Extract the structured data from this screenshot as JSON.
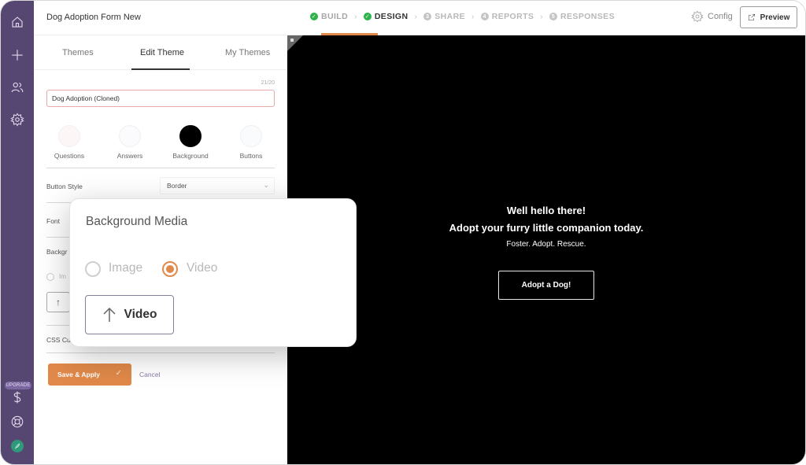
{
  "app": {
    "form_title": "Dog Adoption Form New"
  },
  "rail": {
    "items": [
      {
        "icon": "home-icon"
      },
      {
        "icon": "plus-icon"
      },
      {
        "icon": "users-icon"
      },
      {
        "icon": "gear-icon"
      }
    ],
    "upgrade_label": "UPGRADE",
    "bottom_items": [
      {
        "icon": "dollar-icon"
      },
      {
        "icon": "lifebuoy-icon"
      },
      {
        "icon": "avatar"
      }
    ]
  },
  "steps": [
    {
      "label": "BUILD",
      "marker": "✓",
      "state": "done"
    },
    {
      "label": "DESIGN",
      "marker": "✓",
      "state": "active"
    },
    {
      "label": "SHARE",
      "marker": "3",
      "state": "pending"
    },
    {
      "label": "REPORTS",
      "marker": "4",
      "state": "pending"
    },
    {
      "label": "RESPONSES",
      "marker": "5",
      "state": "pending"
    }
  ],
  "header": {
    "config_label": "Config",
    "preview_label": "Preview"
  },
  "panel": {
    "tabs": [
      {
        "label": "Themes"
      },
      {
        "label": "Edit Theme",
        "active": true
      },
      {
        "label": "My Themes"
      }
    ],
    "char_count": "21/20",
    "theme_name": "Dog Adoption (Cloned)",
    "swatches": [
      {
        "label": "Questions",
        "color": "#fdf6f6"
      },
      {
        "label": "Answers",
        "color": "#fbfbfd"
      },
      {
        "label": "Background",
        "color": "#000000"
      },
      {
        "label": "Buttons",
        "color": "#fafbfc"
      }
    ],
    "button_style_label": "Button Style",
    "button_style_value": "Border",
    "font_label": "Font",
    "background_label": "Backgr",
    "bg_radio_label": "Im",
    "css_label": "CSS Cu",
    "save_label": "Save & Apply",
    "cancel_label": "Cancel"
  },
  "preview": {
    "heading_1": "Well hello there!",
    "heading_2": "Adopt your furry little companion today.",
    "subtitle": "Foster. Adopt. Rescue.",
    "button_label": "Adopt a Dog!"
  },
  "popup": {
    "title": "Background Media",
    "options": [
      {
        "label": "Image",
        "checked": false
      },
      {
        "label": "Video",
        "checked": true
      }
    ],
    "upload_label": "Video"
  },
  "colors": {
    "rail": "#564672",
    "accent": "#e0894a",
    "success": "#2db34a"
  }
}
